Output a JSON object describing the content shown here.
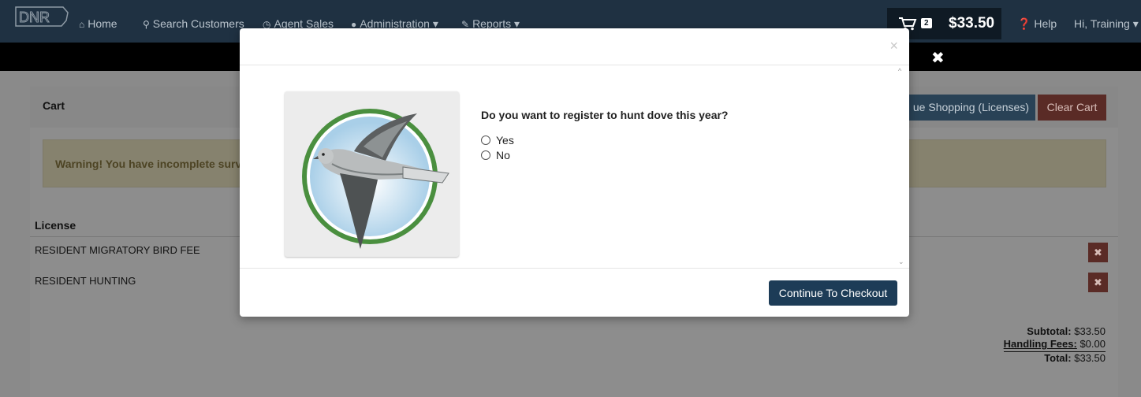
{
  "nav": {
    "home": "Home",
    "search_customers": "Search Customers",
    "agent_sales": "Agent Sales",
    "administration": "Administration",
    "reports": "Reports",
    "help": "Help",
    "user_greeting": "Hi, Training",
    "brand_text": "DNR"
  },
  "cart_widget": {
    "count": "2",
    "total": "$33.50"
  },
  "cart_panel": {
    "title": "Cart",
    "continue_shopping": "ue Shopping (Licenses)",
    "clear_cart": "Clear Cart",
    "warning": "Warning! You have incomplete surveys",
    "license_header": "License",
    "items": [
      {
        "name": "RESIDENT MIGRATORY BIRD FEE"
      },
      {
        "name": "RESIDENT HUNTING"
      }
    ],
    "totals": {
      "subtotal_label": "Subtotal:",
      "subtotal_value": "$33.50",
      "handling_label": "Handling Fees:",
      "handling_value": "$0.00",
      "total_label": "Total:",
      "total_value": "$33.50"
    }
  },
  "modal": {
    "close_glyph": "×",
    "question": "Do you want to register to hunt dove this year?",
    "options": [
      "Yes",
      "No"
    ],
    "checkout_button": "Continue To Checkout"
  },
  "colors": {
    "navbar": "#1f3142",
    "primary_button": "#1d3c57",
    "danger": "#5a2b26"
  }
}
